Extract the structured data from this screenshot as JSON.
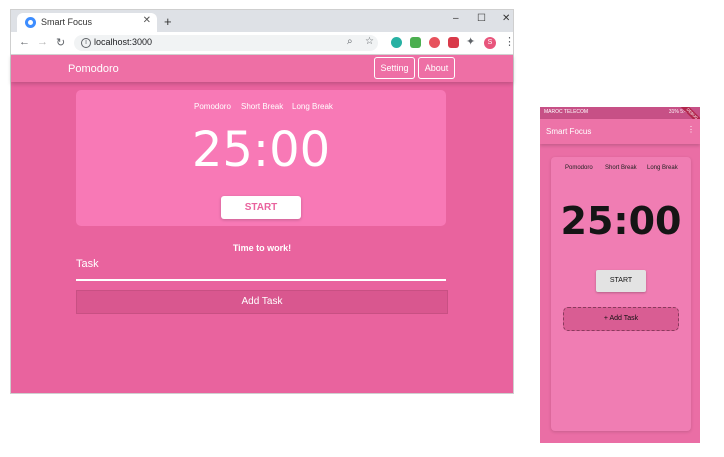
{
  "browser": {
    "tab_title": "Smart Focus",
    "tab_close": "✕",
    "new_tab": "+",
    "url": "localhost:3000",
    "controls": {
      "minimize": "–",
      "maximize": "☐",
      "close": "✕"
    },
    "avatar_letter": "S"
  },
  "web": {
    "brand": "Pomodoro",
    "nav": {
      "setting": "Setting",
      "about": "About"
    },
    "modes": [
      "Pomodoro",
      "Short Break",
      "Long Break"
    ],
    "time": "25:00",
    "start_label": "START",
    "status": "Time to work!",
    "task_label": "Task",
    "add_task_label": "Add Task"
  },
  "phone": {
    "carrier": "MAROC TELECOM",
    "status_right": "31% 5:49",
    "debug_banner": "DEBUG",
    "title": "Smart Focus",
    "modes": [
      "Pomodoro",
      "Short Break",
      "Long Break"
    ],
    "time": "25:00",
    "start_label": "START",
    "add_task_label": "+ Add Task"
  },
  "colors": {
    "page_bg": "#e9639e",
    "header_bg": "#ee6fa5",
    "card_bg": "#f879b6",
    "add_task_bg": "#d9578f",
    "accent_text": "#e9639e"
  }
}
